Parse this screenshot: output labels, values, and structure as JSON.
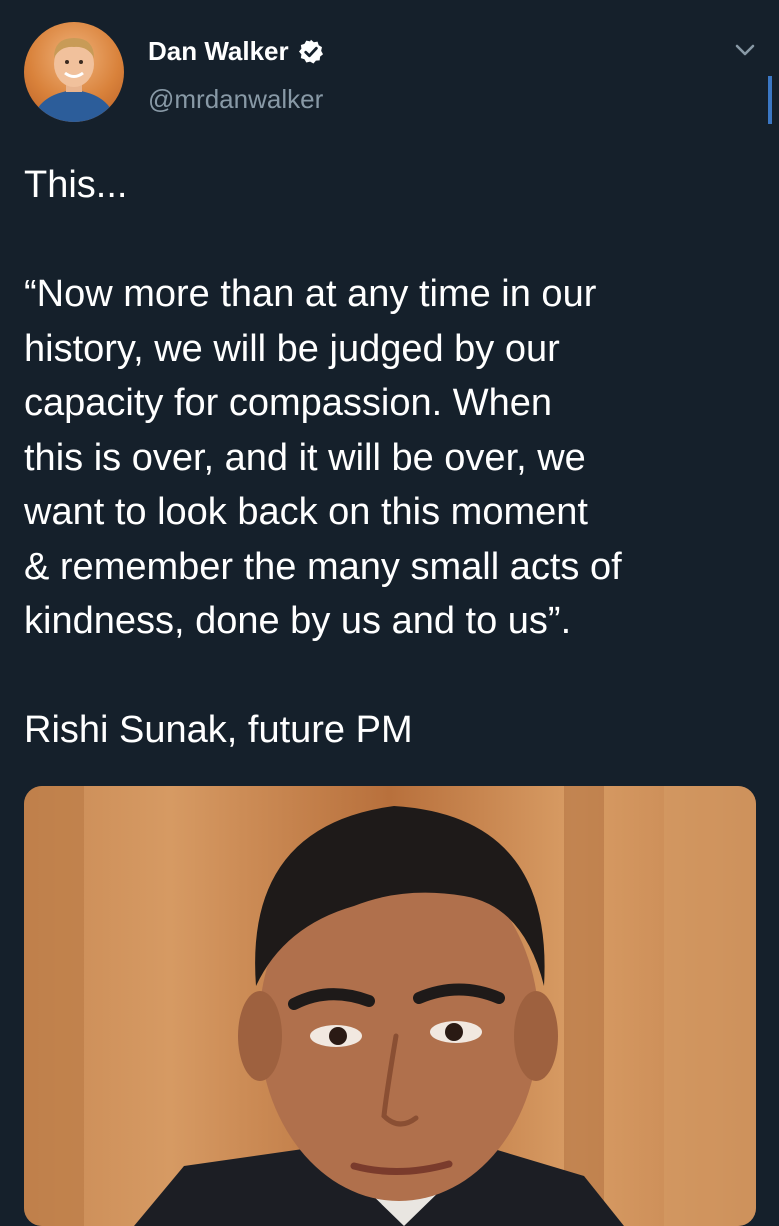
{
  "tweet": {
    "author": {
      "display_name": "Dan Walker",
      "handle": "@mrdanwalker",
      "verified": true
    },
    "text_lines": [
      "This...",
      "",
      "“Now more than at any time in our",
      "history, we will be judged by our",
      "capacity for compassion. When",
      "this is over, and it will be over, we",
      "want to look back on this moment",
      "& remember the many small acts of",
      "kindness, done by us and to us”.",
      "",
      "Rishi Sunak, future PM"
    ],
    "media": {
      "kind": "photo"
    }
  },
  "icons": {
    "verified": "verified-badge-icon",
    "menu": "chevron-down-icon"
  },
  "colors": {
    "background": "#15202b",
    "text": "#ffffff",
    "secondary_text": "#8899a6",
    "accent": "#3b77c4"
  }
}
